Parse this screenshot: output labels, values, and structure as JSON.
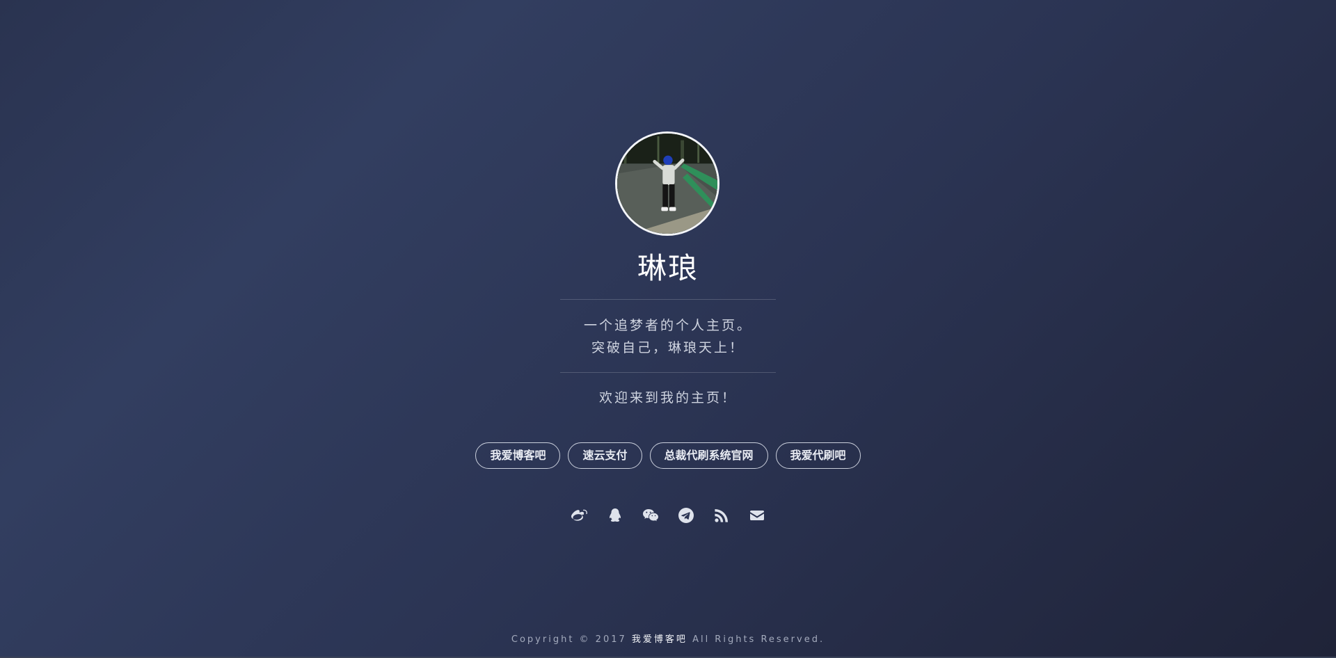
{
  "profile": {
    "name": "琳琅",
    "bio_line1": "一个追梦者的个人主页。",
    "bio_line2": "突破自己，琳琅天上！",
    "welcome": "欢迎来到我的主页！"
  },
  "links": [
    {
      "label": "我爱博客吧"
    },
    {
      "label": "速云支付"
    },
    {
      "label": "总裁代刷系统官网"
    },
    {
      "label": "我爱代刷吧"
    }
  ],
  "socials": [
    {
      "icon": "weibo-icon"
    },
    {
      "icon": "qq-icon"
    },
    {
      "icon": "wechat-icon"
    },
    {
      "icon": "telegram-icon"
    },
    {
      "icon": "rss-icon"
    },
    {
      "icon": "email-icon"
    }
  ],
  "footer": {
    "prefix": "Copyright © 2017",
    "brand": "我爱博客吧",
    "suffix": "All Rights Reserved."
  },
  "colors": {
    "background_start": "#323e60",
    "background_end": "#1f2338",
    "text": "#e8ebf2"
  }
}
